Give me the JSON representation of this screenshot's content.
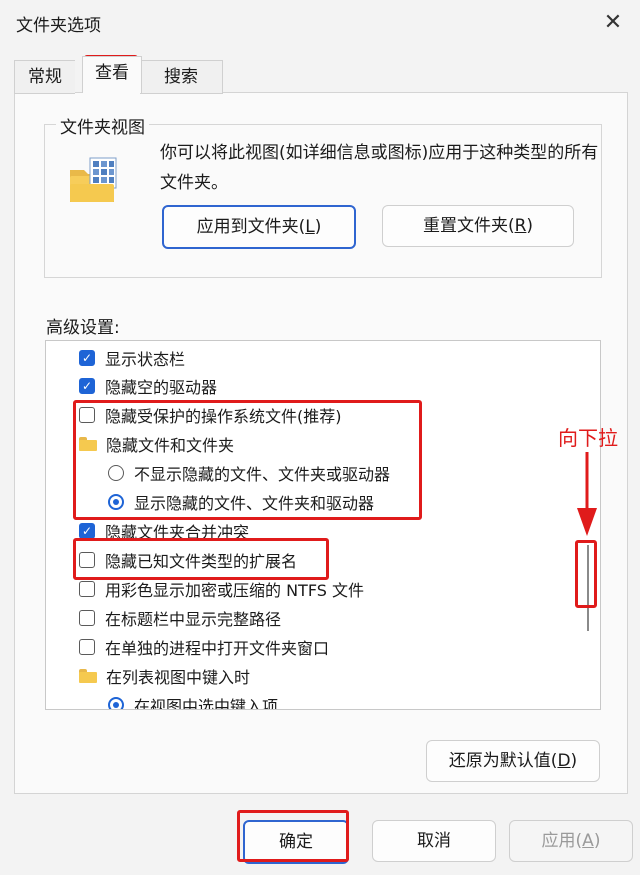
{
  "window": {
    "title": "文件夹选项",
    "close_glyph": "✕"
  },
  "tabs": [
    {
      "label": "常规",
      "active": false
    },
    {
      "label": "查看",
      "active": true
    },
    {
      "label": "搜索",
      "active": false
    }
  ],
  "folder_views": {
    "legend": "文件夹视图",
    "description": "你可以将此视图(如详细信息或图标)应用于这种类型的所有文件夹。",
    "apply_button": {
      "text": "应用到文件夹(",
      "key": "L",
      "end": ")"
    },
    "reset_button": {
      "text": "重置文件夹(",
      "key": "R",
      "end": ")"
    }
  },
  "advanced": {
    "label": "高级设置:",
    "items": [
      {
        "type": "checkbox",
        "checked": true,
        "label": "显示状态栏"
      },
      {
        "type": "checkbox",
        "checked": true,
        "label": "隐藏空的驱动器"
      },
      {
        "type": "checkbox",
        "checked": false,
        "label": "隐藏受保护的操作系统文件(推荐)"
      },
      {
        "type": "folder",
        "label": "隐藏文件和文件夹"
      },
      {
        "type": "radio",
        "checked": false,
        "label": "不显示隐藏的文件、文件夹或驱动器"
      },
      {
        "type": "radio",
        "checked": true,
        "label": "显示隐藏的文件、文件夹和驱动器"
      },
      {
        "type": "checkbox",
        "checked": true,
        "label": "隐藏文件夹合并冲突"
      },
      {
        "type": "checkbox",
        "checked": false,
        "label": "隐藏已知文件类型的扩展名"
      },
      {
        "type": "checkbox",
        "checked": false,
        "label": "用彩色显示加密或压缩的 NTFS 文件"
      },
      {
        "type": "checkbox",
        "checked": false,
        "label": "在标题栏中显示完整路径"
      },
      {
        "type": "checkbox",
        "checked": false,
        "label": "在单独的进程中打开文件夹窗口"
      },
      {
        "type": "folder",
        "label": "在列表视图中键入时"
      },
      {
        "type": "radio",
        "checked": true,
        "label": "在视图中选中键入项"
      }
    ],
    "restore_button": {
      "text": "还原为默认值(",
      "key": "D",
      "end": ")"
    }
  },
  "footer": {
    "ok": "确定",
    "cancel": "取消",
    "apply": {
      "text": "应用(",
      "key": "A",
      "end": ")",
      "enabled": false
    }
  },
  "annotation": {
    "text": "向下拉",
    "color": "#e01b1b"
  },
  "colors": {
    "accent": "#1e64d6",
    "annotation": "#e01b1b",
    "folder": "#f5c94f"
  }
}
